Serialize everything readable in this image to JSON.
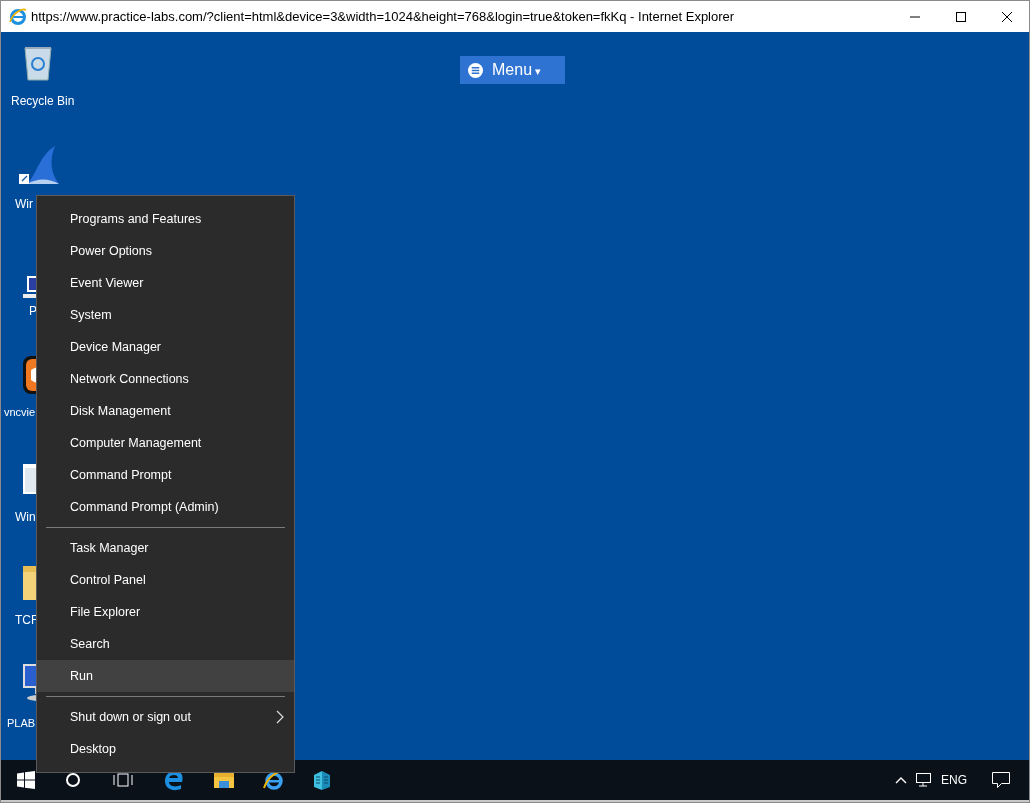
{
  "window": {
    "title": "https://www.practice-labs.com/?client=html&device=3&width=1024&height=768&login=true&token=fkKq - Internet Explorer"
  },
  "menu_button": {
    "label": "Menu",
    "caret": "▾"
  },
  "desktop_icons": [
    {
      "kind": "recycle",
      "label": "Recycle Bin"
    },
    {
      "kind": "shark",
      "label": "Wir"
    },
    {
      "kind": "laptop",
      "label": "P"
    },
    {
      "kind": "vnc",
      "label": "vncvie"
    },
    {
      "kind": "window",
      "label": "Win"
    },
    {
      "kind": "folder",
      "label": "TCF"
    },
    {
      "kind": "monitor",
      "label": "PLAB"
    }
  ],
  "context_menu": {
    "groups": [
      [
        {
          "label": "Programs and Features",
          "selected": false
        },
        {
          "label": "Power Options",
          "selected": false
        },
        {
          "label": "Event Viewer",
          "selected": false
        },
        {
          "label": "System",
          "selected": false
        },
        {
          "label": "Device Manager",
          "selected": false
        },
        {
          "label": "Network Connections",
          "selected": false
        },
        {
          "label": "Disk Management",
          "selected": false
        },
        {
          "label": "Computer Management",
          "selected": false
        },
        {
          "label": "Command Prompt",
          "selected": false
        },
        {
          "label": "Command Prompt (Admin)",
          "selected": false
        }
      ],
      [
        {
          "label": "Task Manager",
          "selected": false
        },
        {
          "label": "Control Panel",
          "selected": false
        },
        {
          "label": "File Explorer",
          "selected": false
        },
        {
          "label": "Search",
          "selected": false
        },
        {
          "label": "Run",
          "selected": true
        }
      ],
      [
        {
          "label": "Shut down or sign out",
          "selected": false,
          "submenu": true
        },
        {
          "label": "Desktop",
          "selected": false
        }
      ]
    ]
  },
  "taskbar": {
    "language": "ENG"
  }
}
